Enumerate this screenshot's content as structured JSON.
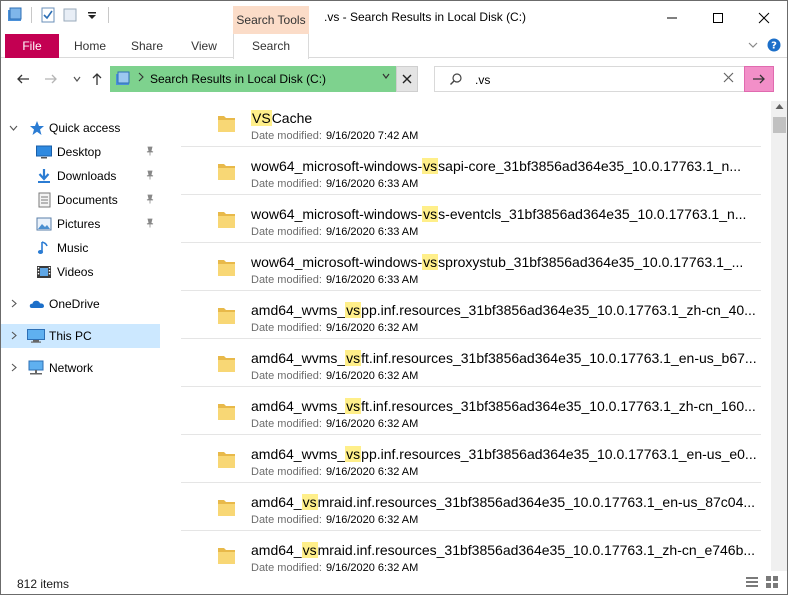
{
  "window": {
    "title": ".vs - Search Results in Local Disk (C:)",
    "context_tab_header": "Search Tools"
  },
  "ribbon": {
    "tabs": [
      "File",
      "Home",
      "Share",
      "View",
      "Search"
    ]
  },
  "nav": {
    "address_crumb": "Search Results in Local Disk (C:)",
    "search_query": ".vs"
  },
  "sidebar": {
    "items": [
      {
        "label": "Quick access",
        "icon": "star-icon"
      },
      {
        "label": "Desktop",
        "icon": "desktop-icon"
      },
      {
        "label": "Downloads",
        "icon": "download-icon"
      },
      {
        "label": "Documents",
        "icon": "documents-icon"
      },
      {
        "label": "Pictures",
        "icon": "pictures-icon"
      },
      {
        "label": "Music",
        "icon": "music-icon"
      },
      {
        "label": "Videos",
        "icon": "videos-icon"
      },
      {
        "label": "OneDrive",
        "icon": "cloud-icon"
      },
      {
        "label": "This PC",
        "icon": "computer-icon"
      },
      {
        "label": "Network",
        "icon": "network-icon"
      }
    ]
  },
  "results": {
    "meta_label": "Date modified:",
    "items": [
      {
        "pre": "",
        "hl": "VS",
        "post": "Cache",
        "date": "9/16/2020 7:42 AM"
      },
      {
        "pre": "wow64_microsoft-windows-",
        "hl": "vs",
        "post": "sapi-core_31bf3856ad364e35_10.0.17763.1_n...",
        "date": "9/16/2020 6:33 AM"
      },
      {
        "pre": "wow64_microsoft-windows-",
        "hl": "vs",
        "post": "s-eventcls_31bf3856ad364e35_10.0.17763.1_n...",
        "date": "9/16/2020 6:33 AM"
      },
      {
        "pre": "wow64_microsoft-windows-",
        "hl": "vs",
        "post": "sproxystub_31bf3856ad364e35_10.0.17763.1_...",
        "date": "9/16/2020 6:33 AM"
      },
      {
        "pre": "amd64_wvms_",
        "hl": "vs",
        "post": "pp.inf.resources_31bf3856ad364e35_10.0.17763.1_zh-cn_40...",
        "date": "9/16/2020 6:32 AM"
      },
      {
        "pre": "amd64_wvms_",
        "hl": "vs",
        "post": "ft.inf.resources_31bf3856ad364e35_10.0.17763.1_en-us_b67...",
        "date": "9/16/2020 6:32 AM"
      },
      {
        "pre": "amd64_wvms_",
        "hl": "vs",
        "post": "ft.inf.resources_31bf3856ad364e35_10.0.17763.1_zh-cn_160...",
        "date": "9/16/2020 6:32 AM"
      },
      {
        "pre": "amd64_wvms_",
        "hl": "vs",
        "post": "pp.inf.resources_31bf3856ad364e35_10.0.17763.1_en-us_e0...",
        "date": "9/16/2020 6:32 AM"
      },
      {
        "pre": "amd64_",
        "hl": "vs",
        "post": "mraid.inf.resources_31bf3856ad364e35_10.0.17763.1_en-us_87c04...",
        "date": "9/16/2020 6:32 AM"
      },
      {
        "pre": "amd64_",
        "hl": "vs",
        "post": "mraid.inf.resources_31bf3856ad364e35_10.0.17763.1_zh-cn_e746b...",
        "date": "9/16/2020 6:32 AM"
      }
    ]
  },
  "status": {
    "item_count": "812 items"
  },
  "colors": {
    "file_tab": "#c30052",
    "context_tab": "#fbdcc8",
    "address_highlight": "#7ed28e",
    "search_go_highlight": "#f28fc8",
    "selected_nav": "#cce8ff",
    "match_highlight": "#ffef8a"
  }
}
